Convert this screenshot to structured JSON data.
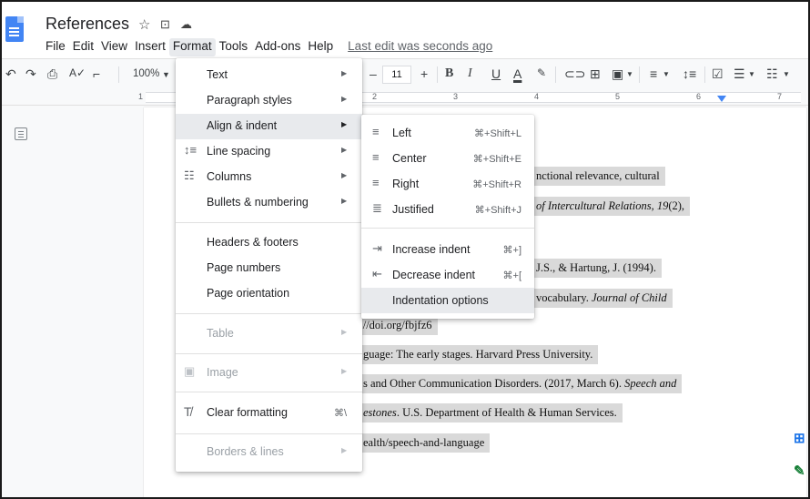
{
  "app": {
    "title": "References",
    "last_edit": "Last edit was seconds ago"
  },
  "menubar": [
    "File",
    "Edit",
    "View",
    "Insert",
    "Format",
    "Tools",
    "Add-ons",
    "Help"
  ],
  "toolbar": {
    "zoom": "100%",
    "font_size": "11",
    "minus": "–",
    "plus": "+",
    "bold": "B",
    "italic": "I",
    "underline": "U",
    "text_color": "A"
  },
  "ruler": {
    "numbers": [
      "1",
      "2",
      "3",
      "4",
      "5",
      "6",
      "7"
    ]
  },
  "format_menu": {
    "text": "Text",
    "paragraph_styles": "Paragraph styles",
    "align_indent": "Align & indent",
    "line_spacing": "Line spacing",
    "columns": "Columns",
    "bullets": "Bullets & numbering",
    "headers_footers": "Headers & footers",
    "page_numbers": "Page numbers",
    "page_orientation": "Page orientation",
    "table": "Table",
    "image": "Image",
    "clear_formatting": "Clear formatting",
    "clear_formatting_shortcut": "⌘\\",
    "borders_lines": "Borders & lines"
  },
  "align_submenu": {
    "left": {
      "label": "Left",
      "shortcut": "⌘+Shift+L"
    },
    "center": {
      "label": "Center",
      "shortcut": "⌘+Shift+E"
    },
    "right": {
      "label": "Right",
      "shortcut": "⌘+Shift+R"
    },
    "justified": {
      "label": "Justified",
      "shortcut": "⌘+Shift+J"
    },
    "increase_indent": {
      "label": "Increase indent",
      "shortcut": "⌘+]"
    },
    "decrease_indent": {
      "label": "Decrease indent",
      "shortcut": "⌘+["
    },
    "indentation_options": {
      "label": "Indentation options"
    }
  },
  "document_lines": {
    "l1": "nctional relevance, cultural",
    "l2_italic": "of Intercultural Relations, 19",
    "l2_rest": "(2),",
    "l3": "J.S., & Hartung, J. (1994).",
    "l4_plain": "vocabulary. ",
    "l4_italic": "Journal of Child",
    "l5": "p://doi.org/fbjfz6",
    "l6": "guage: The early stages. Harvard Press University.",
    "l7_plain": "s and Other Communication Disorders. (2017, March 6). ",
    "l7_italic": "Speech and",
    "l8_italic": "estones",
    "l8_rest": ". U.S. Department of Health & Human Services.",
    "l9": "ealth/speech-and-language"
  },
  "colors": {
    "accent": "#4285f4",
    "highlight": "#d9d9d9",
    "menu_hover": "#e8eaed"
  }
}
